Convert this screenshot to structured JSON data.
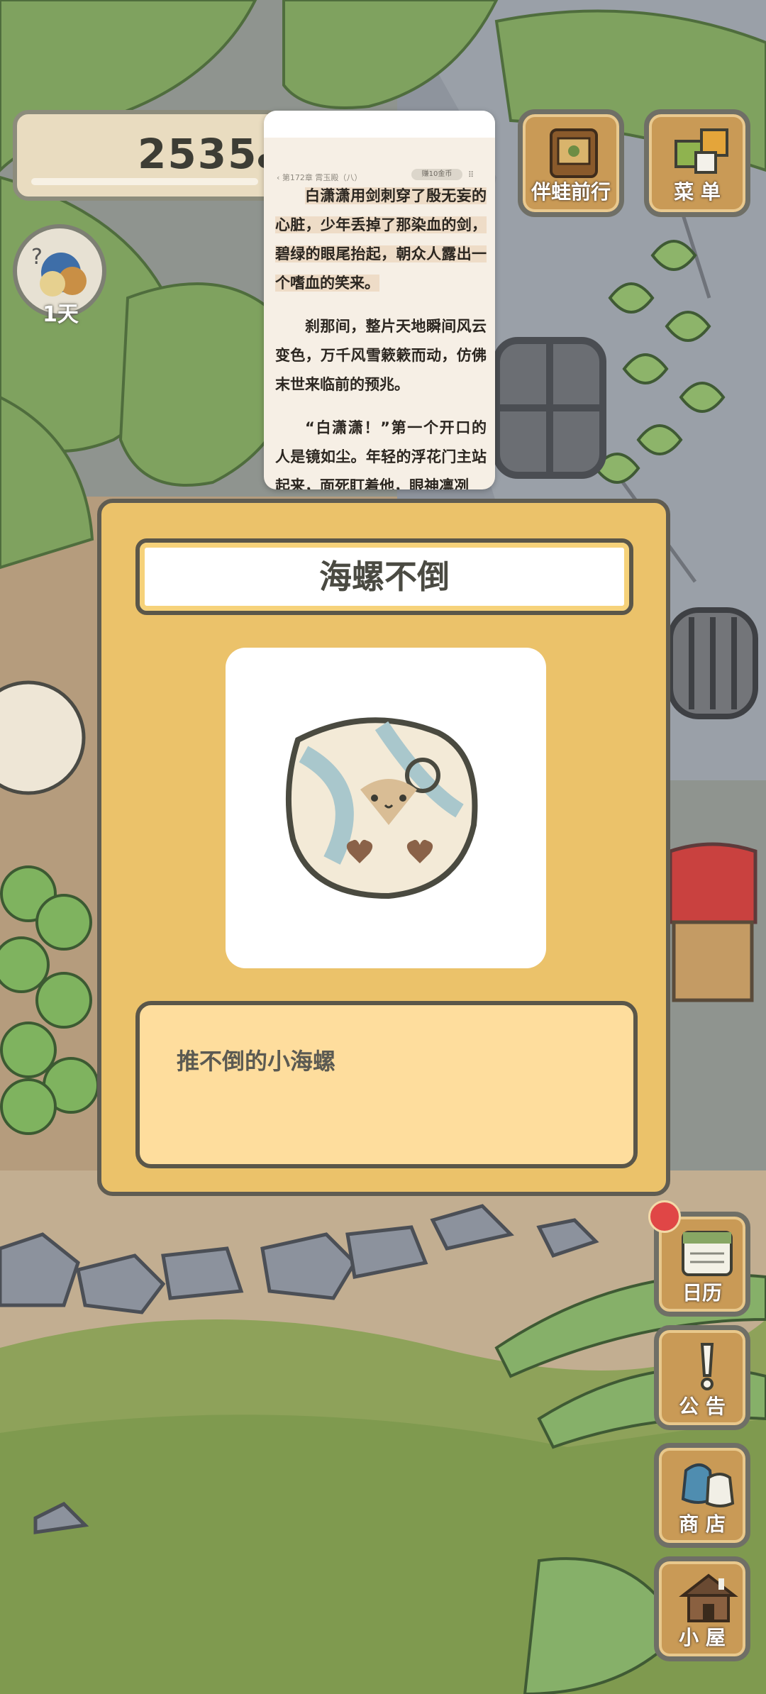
{
  "hud": {
    "clover_count": "2535",
    "day_label": "1天"
  },
  "top_buttons": {
    "travel_label": "伴蛙前行",
    "menu_label": "菜 单"
  },
  "reader": {
    "chapter": "‹ 第172章 霄玉殿（八）",
    "coin_badge": "赚10金币",
    "paragraph_1": "白潇潇用剑刺穿了殷无妄的心脏，少年丢掉了那染血的剑，碧绿的眼尾抬起，朝众人露出一个嗜血的笑来。",
    "paragraph_2": "刹那间，整片天地瞬间风云变色，万千风雪簌簌而动，仿佛末世来临前的预兆。",
    "paragraph_3": "“白潇潇！”第一个开口的人是镜如尘。年轻的浮花门主站起来，面死盯着他，眼神凛冽"
  },
  "item_card": {
    "title": "海螺不倒",
    "description": "推不倒的小海螺"
  },
  "side_buttons": {
    "calendar_label": "日历",
    "notice_label": "公 告",
    "shop_label": "商 店",
    "house_label": "小 屋"
  },
  "icons": {
    "clover": "clover-leaf-icon",
    "calendar": "calendar-icon",
    "notice": "exclamation-icon",
    "shop": "bags-icon",
    "house": "house-icon",
    "travel": "photo-album-icon",
    "menu": "menu-tiles-icon"
  },
  "colors": {
    "card_bg": "#ebc26a",
    "desc_bg": "#fedd9d",
    "wood": "#c99a56",
    "notify": "#e04646"
  }
}
